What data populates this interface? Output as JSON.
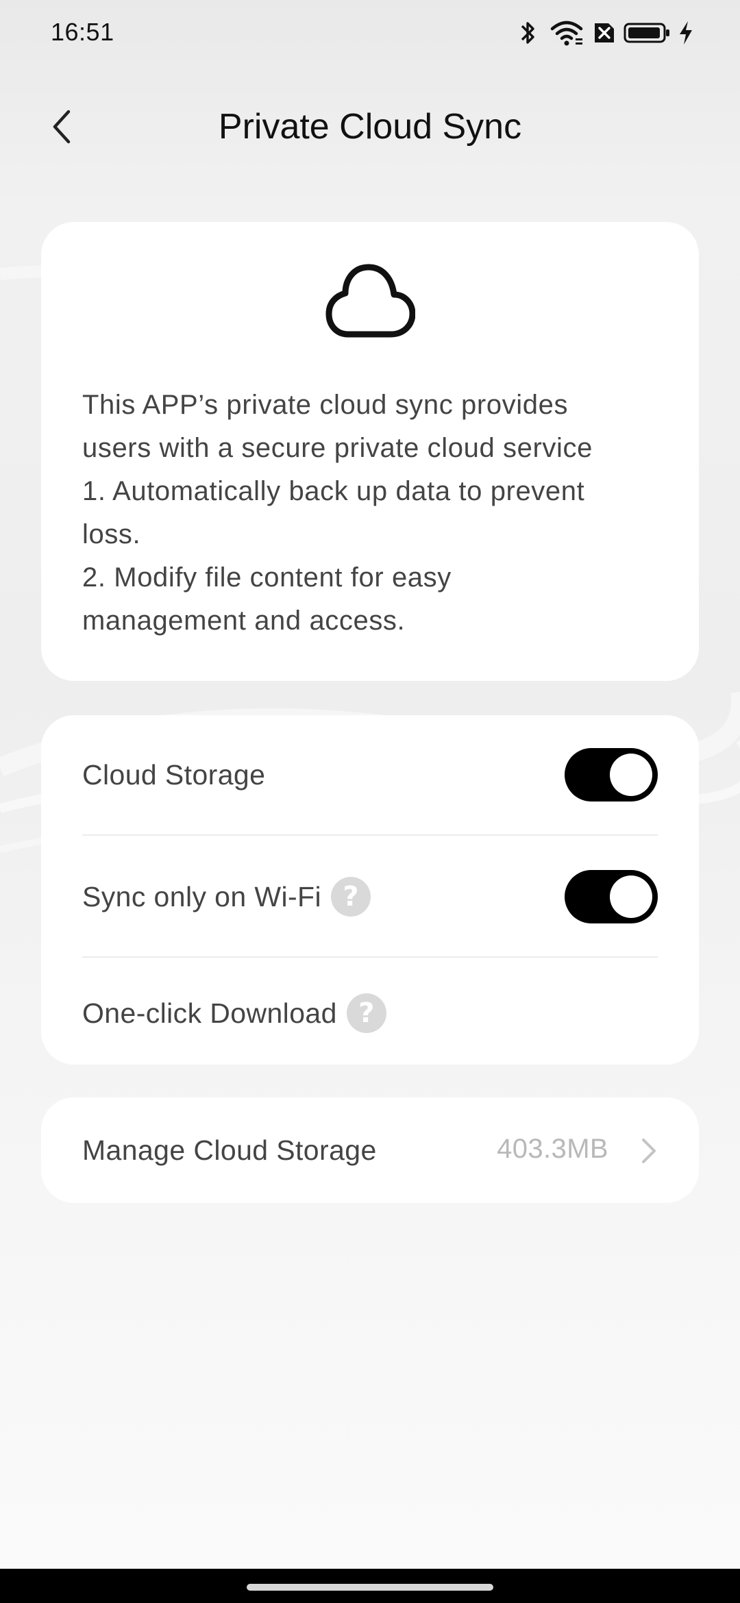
{
  "status_bar": {
    "time": "16:51",
    "icons": [
      "bluetooth-icon",
      "wifi-icon",
      "sim-off-icon",
      "battery-icon",
      "charging-icon"
    ]
  },
  "header": {
    "title": "Private Cloud Sync",
    "back_icon": "chevron-left-icon"
  },
  "info_card": {
    "icon": "cloud-icon",
    "lines": [
      "This APP’s private cloud sync provides",
      "users with a secure private cloud service",
      "1. Automatically back up data to prevent",
      "loss.",
      "2. Modify file content for easy",
      "management and access."
    ]
  },
  "settings": {
    "cloud_storage": {
      "label": "Cloud Storage",
      "enabled": true
    },
    "sync_wifi": {
      "label": "Sync only on Wi-Fi",
      "help": "?",
      "enabled": true
    },
    "one_click_download": {
      "label": "One-click Download",
      "help": "?"
    }
  },
  "manage": {
    "label": "Manage Cloud Storage",
    "value": "403.3MB",
    "icon": "chevron-right-icon"
  },
  "colors": {
    "toggle_on": "#000000",
    "card_bg": "#ffffff",
    "muted_text": "#b8b8b8"
  }
}
